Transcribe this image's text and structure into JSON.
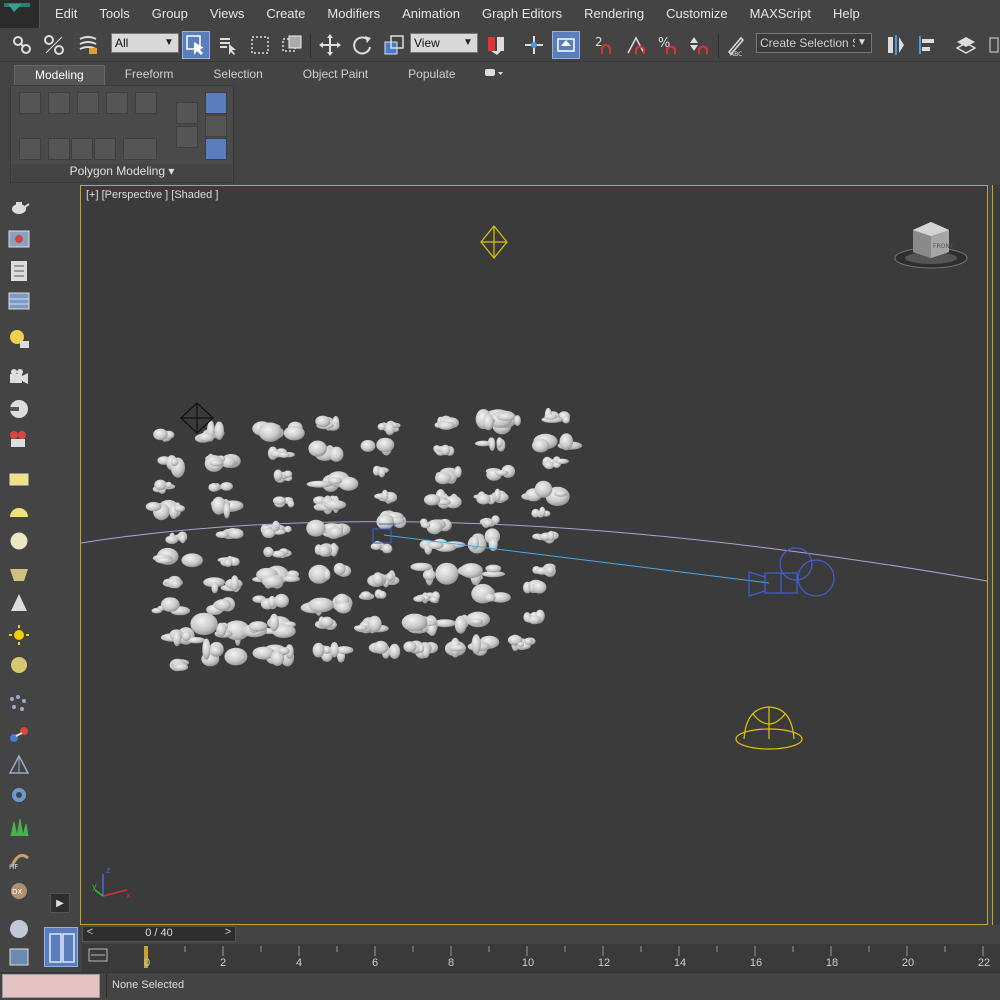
{
  "menu": {
    "items": [
      "Edit",
      "Tools",
      "Group",
      "Views",
      "Create",
      "Modifiers",
      "Animation",
      "Graph Editors",
      "Rendering",
      "Customize",
      "MAXScript",
      "Help"
    ]
  },
  "toolbar": {
    "selection_filter": "All",
    "reference_coord": "View",
    "named_selection_placeholder": "Create Selection Se"
  },
  "ribbon": {
    "tabs": [
      "Modeling",
      "Freeform",
      "Selection",
      "Object Paint",
      "Populate"
    ],
    "active_tab": "Modeling",
    "panel_label": "Polygon Modeling ▾"
  },
  "viewport": {
    "label": "[+] [Perspective ] [Shaded ]",
    "viewcube_label": "FRONT",
    "axis_labels": {
      "x": "x",
      "y": "y",
      "z": "z"
    }
  },
  "time_slider": {
    "text": "0 / 40",
    "prev": "<",
    "next": ">"
  },
  "trackbar": {
    "ticks": [
      "0",
      "2",
      "4",
      "6",
      "8",
      "10",
      "12",
      "14",
      "16",
      "18",
      "20",
      "22"
    ]
  },
  "status": {
    "text": "None Selected"
  },
  "colors": {
    "ui_bg": "#444444",
    "viewport_bg": "#3b3b3b",
    "viewport_border": "#c2a52a",
    "active_blue": "#5a7dbb",
    "cloud": "#d6d6d6",
    "light_yellow": "#e0c400",
    "camera_blue": "#3f5fd6",
    "path_purple": "#b79ad6"
  }
}
